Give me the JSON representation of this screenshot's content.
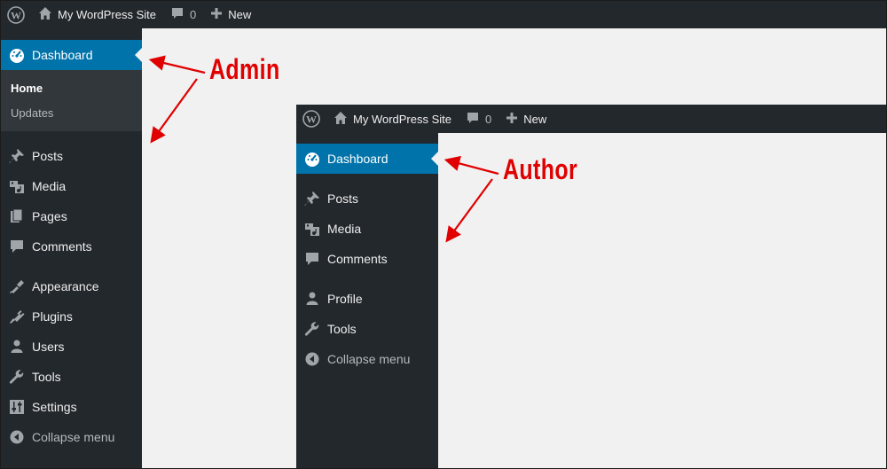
{
  "admin_view": {
    "topbar": {
      "site_name": "My WordPress Site",
      "comments_count": "0",
      "new_label": "New"
    },
    "menu": {
      "dashboard": "Dashboard",
      "home": "Home",
      "updates": "Updates",
      "posts": "Posts",
      "media": "Media",
      "pages": "Pages",
      "comments": "Comments",
      "appearance": "Appearance",
      "plugins": "Plugins",
      "users": "Users",
      "tools": "Tools",
      "settings": "Settings",
      "collapse": "Collapse menu"
    },
    "annotation": "Admin"
  },
  "author_view": {
    "topbar": {
      "site_name": "My WordPress Site",
      "comments_count": "0",
      "new_label": "New"
    },
    "menu": {
      "dashboard": "Dashboard",
      "posts": "Posts",
      "media": "Media",
      "comments": "Comments",
      "profile": "Profile",
      "tools": "Tools",
      "collapse": "Collapse menu"
    },
    "annotation": "Author"
  },
  "colors": {
    "adminbar_bg": "#23282d",
    "submenu_bg": "#32373c",
    "active_bg": "#0073aa",
    "content_bg": "#f1f1f1",
    "annotation_red": "#e00000"
  },
  "icons": [
    "wordpress-logo-icon",
    "home-icon",
    "comment-bubble-icon",
    "plus-icon",
    "dashboard-gauge-icon",
    "pushpin-icon",
    "media-icon",
    "pages-icon",
    "appearance-brush-icon",
    "plugin-icon",
    "user-icon",
    "wrench-icon",
    "settings-sliders-icon",
    "collapse-arrow-icon"
  ]
}
